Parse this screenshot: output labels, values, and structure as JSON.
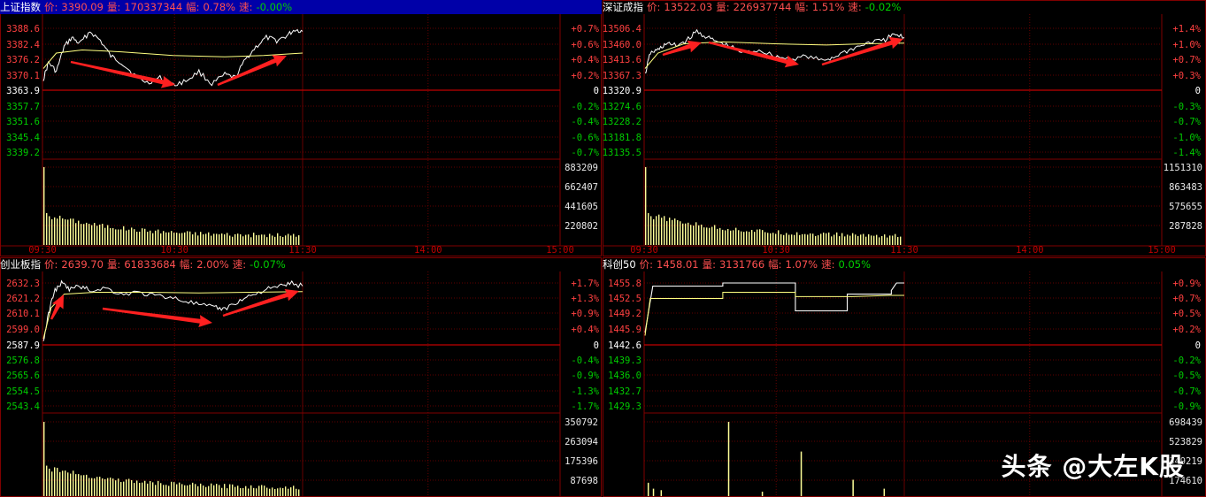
{
  "panels": [
    {
      "name": "上证指数",
      "price_label": "价:",
      "price": "3390.09",
      "volume_label": "量:",
      "volume": "170337344",
      "change_label": "幅:",
      "change": "0.78%",
      "speed_label": "速:",
      "speed": "-0.00%",
      "selected": true,
      "prices_up": [
        "3388.6",
        "3382.4",
        "3376.2",
        "3370.1"
      ],
      "price_base": "3363.9",
      "prices_down": [
        "3357.7",
        "3351.6",
        "3345.4",
        "3339.2"
      ],
      "pct_up": [
        "+0.7%",
        "+0.6%",
        "+0.4%",
        "+0.2%"
      ],
      "pct_base": "0",
      "pct_down": [
        "-0.2%",
        "-0.4%",
        "-0.6%",
        "-0.7%"
      ],
      "vol_ticks": [
        "883209",
        "662407",
        "441605",
        "220802"
      ],
      "time_ticks": [
        "09:30",
        "10:30",
        "11:30",
        "14:00",
        "15:00"
      ]
    },
    {
      "name": "深证成指",
      "price_label": "价:",
      "price": "13522.03",
      "volume_label": "量:",
      "volume": "226937744",
      "change_label": "幅:",
      "change": "1.51%",
      "speed_label": "速:",
      "speed": "-0.02%",
      "selected": false,
      "prices_up": [
        "13506.4",
        "13460.0",
        "13413.6",
        "13367.3"
      ],
      "price_base": "13320.9",
      "prices_down": [
        "13274.6",
        "13228.2",
        "13181.8",
        "13135.5"
      ],
      "pct_up": [
        "+1.4%",
        "+1.0%",
        "+0.7%",
        "+0.3%"
      ],
      "pct_base": "0",
      "pct_down": [
        "-0.3%",
        "-0.7%",
        "-1.0%",
        "-1.4%"
      ],
      "vol_ticks": [
        "1151310",
        "863483",
        "575655",
        "287828"
      ],
      "time_ticks": [
        "09:30",
        "10:30",
        "11:30",
        "14:00",
        "15:00"
      ]
    },
    {
      "name": "创业板指",
      "price_label": "价:",
      "price": "2639.70",
      "volume_label": "量:",
      "volume": "61833684",
      "change_label": "幅:",
      "change": "2.00%",
      "speed_label": "速:",
      "speed": "-0.07%",
      "selected": false,
      "prices_up": [
        "2632.3",
        "2621.2",
        "2610.1",
        "2599.0"
      ],
      "price_base": "2587.9",
      "prices_down": [
        "2576.8",
        "2565.6",
        "2554.5",
        "2543.4"
      ],
      "pct_up": [
        "+1.7%",
        "+1.3%",
        "+0.9%",
        "+0.4%"
      ],
      "pct_base": "0",
      "pct_down": [
        "-0.4%",
        "-0.9%",
        "-1.3%",
        "-1.7%"
      ],
      "vol_ticks": [
        "350792",
        "263094",
        "175396",
        "87698"
      ],
      "time_ticks": []
    },
    {
      "name": "科创50",
      "price_label": "价:",
      "price": "1458.01",
      "volume_label": "量:",
      "volume": "3131766",
      "change_label": "幅:",
      "change": "1.07%",
      "speed_label": "速:",
      "speed": "0.05%",
      "selected": false,
      "prices_up": [
        "1455.8",
        "1452.5",
        "1449.2",
        "1445.9"
      ],
      "price_base": "1442.6",
      "prices_down": [
        "1439.3",
        "1436.0",
        "1432.7",
        "1429.3"
      ],
      "pct_up": [
        "+0.9%",
        "+0.7%",
        "+0.5%",
        "+0.2%"
      ],
      "pct_base": "0",
      "pct_down": [
        "-0.2%",
        "-0.5%",
        "-0.7%",
        "-0.9%"
      ],
      "vol_ticks": [
        "698439",
        "523829",
        "349219",
        "174610"
      ],
      "time_ticks": []
    }
  ],
  "watermark": "头条 @大左K股",
  "colors": {
    "bg": "#000000",
    "grid": "#800000",
    "up": "#ff4040",
    "down": "#00cc00",
    "price_line": "#ffffff",
    "avg_line": "#ffff80",
    "volume": "#ffff99",
    "arrow": "#ff2020"
  }
}
